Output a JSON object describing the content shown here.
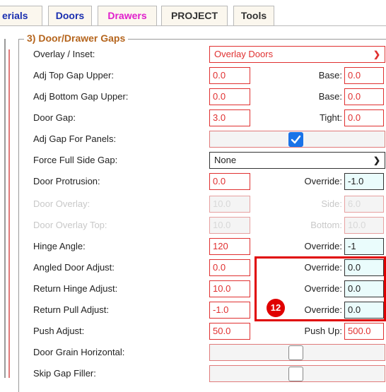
{
  "tabs": [
    {
      "label": "erials"
    },
    {
      "label": "Doors"
    },
    {
      "label": "Drawers"
    },
    {
      "label": "PROJECT"
    },
    {
      "label": "Tools"
    }
  ],
  "section": {
    "legend": "3) Door/Drawer Gaps"
  },
  "rows": {
    "overlay": {
      "label": "Overlay / Inset:",
      "value": "Overlay Doors"
    },
    "adj_top": {
      "label": "Adj Top Gap Upper:",
      "value": "0.0",
      "side_label": "Base:",
      "side_value": "0.0"
    },
    "adj_bottom": {
      "label": "Adj Bottom Gap Upper:",
      "value": "0.0",
      "side_label": "Base:",
      "side_value": "0.0"
    },
    "door_gap": {
      "label": "Door Gap:",
      "value": "3.0",
      "side_label": "Tight:",
      "side_value": "0.0"
    },
    "adj_gap_panels": {
      "label": "Adj Gap For Panels:",
      "checked": true
    },
    "force_side_gap": {
      "label": "Force Full Side Gap:",
      "value": "None"
    },
    "door_protrusion": {
      "label": "Door Protrusion:",
      "value": "0.0",
      "side_label": "Override:",
      "side_value": "-1.0"
    },
    "door_overlay": {
      "label": "Door Overlay:",
      "value": "10.0",
      "side_label": "Side:",
      "side_value": "6.0"
    },
    "door_overlay_top": {
      "label": "Door Overlay Top:",
      "value": "10.0",
      "side_label": "Bottom:",
      "side_value": "10.0"
    },
    "hinge_angle": {
      "label": "Hinge Angle:",
      "value": "120",
      "side_label": "Override:",
      "side_value": "-1"
    },
    "angled_door": {
      "label": "Angled Door Adjust:",
      "value": "0.0",
      "side_label": "Override:",
      "side_value": "0.0"
    },
    "return_hinge": {
      "label": "Return Hinge Adjust:",
      "value": "10.0",
      "side_label": "Override:",
      "side_value": "0.0"
    },
    "return_pull": {
      "label": "Return Pull Adjust:",
      "value": "-1.0",
      "side_label": "Override:",
      "side_value": "0.0"
    },
    "push_adjust": {
      "label": "Push Adjust:",
      "value": "50.0",
      "side_label": "Push Up:",
      "side_value": "500.0"
    },
    "grain_horizontal": {
      "label": "Door Grain Horizontal:",
      "checked": false
    },
    "skip_gap_filler": {
      "label": "Skip Gap Filler:",
      "checked": false
    }
  },
  "badge": {
    "text": "12"
  },
  "colors": {
    "accent_red": "#e03030",
    "highlight": "#e00000",
    "legend": "#b5651d",
    "tab_blue": "#1a2fb0",
    "tab_pink": "#e01ecc"
  },
  "icons": {
    "dropdown": "chevron-down-icon",
    "checkbox": "checkmark-icon"
  }
}
